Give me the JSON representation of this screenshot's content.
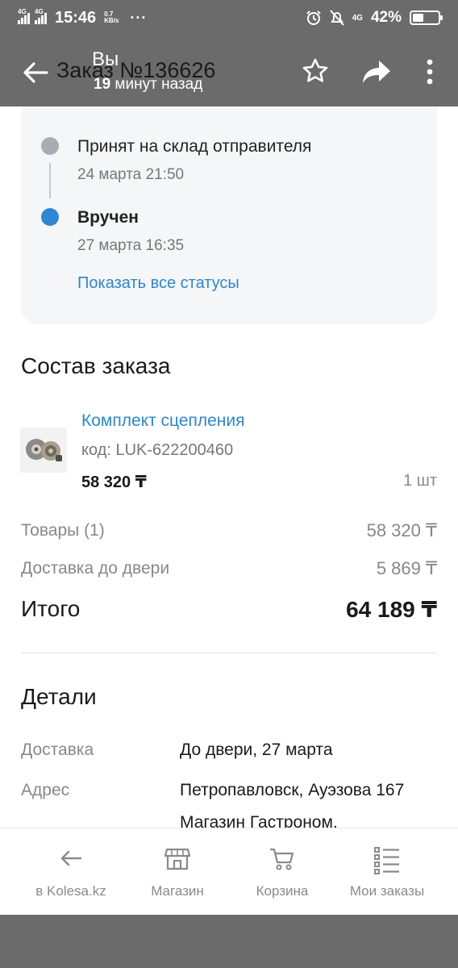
{
  "status_bar": {
    "network_1": "4G",
    "network_2": "4G",
    "time": "15:46",
    "speed_value": "0.7",
    "speed_unit": "KB/s",
    "dots": "···",
    "network_right": "4G",
    "battery": "42%",
    "battery_level": 0.42
  },
  "app_bar": {
    "title": "Заказ №136626",
    "overlay_name": "Вы",
    "overlay_minutes": "19",
    "overlay_time_rest": "минут назад"
  },
  "timeline": {
    "items": [
      {
        "title": "Принят на склад отправителя",
        "date": "24 марта 21:50",
        "dot_color": "#a9adb3"
      },
      {
        "title": "Вручен",
        "date": "27 марта 16:35",
        "dot_color": "#2f86d4"
      }
    ],
    "show_all_link": "Показать все статусы"
  },
  "order": {
    "heading": "Состав заказа",
    "product": {
      "name": "Комплект сцепления",
      "code": "код: LUK-622200460",
      "price": "58 320 ₸",
      "qty": "1 шт"
    },
    "rows": [
      {
        "label": "Товары (1)",
        "value": "58 320 ₸"
      },
      {
        "label": "Доставка до двери",
        "value": "5 869 ₸"
      }
    ],
    "total_label": "Итого",
    "total_value": "64 189 ₸"
  },
  "details": {
    "heading": "Детали",
    "rows": [
      {
        "label": "Доставка",
        "value": "До двери, 27 марта"
      },
      {
        "label": "Адрес",
        "value_line1": "Петропавловск, Ауэзова 167",
        "value_line2": "Магазин Гастроном,"
      }
    ]
  },
  "bottom_nav": {
    "items": [
      {
        "label": "в Kolesa.kz",
        "icon": "arrow-left-icon"
      },
      {
        "label": "Магазин",
        "icon": "shop-icon"
      },
      {
        "label": "Корзина",
        "icon": "cart-icon"
      },
      {
        "label": "Мои заказы",
        "icon": "orders-list-icon"
      }
    ]
  }
}
